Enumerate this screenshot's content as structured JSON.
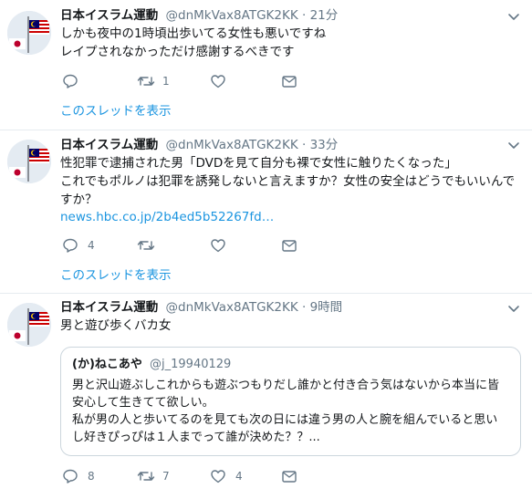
{
  "colors": {
    "link": "#1b95e0",
    "muted": "#657786",
    "divider": "#e6ecf0"
  },
  "tweets": [
    {
      "name": "日本イスラム運動",
      "handle": "@dnMkVax8ATGK2KK",
      "separator": "·",
      "time": "21分",
      "text": "しかも夜中の1時頃出歩いてる女性も悪いですね\nレイプされなかっただけ感謝するべきです",
      "counts": {
        "reply": "",
        "retweet": "1",
        "like": "",
        "dm": ""
      },
      "thread_link": "このスレッドを表示"
    },
    {
      "name": "日本イスラム運動",
      "handle": "@dnMkVax8ATGK2KK",
      "separator": "·",
      "time": "33分",
      "text": "性犯罪で逮捕された男「DVDを見て自分も裸で女性に触りたくなった」\nこれでもポルノは犯罪を誘発しないと言えますか？女性の安全はどうでもいいんですか？",
      "link": "news.hbc.co.jp/2b4ed5b52267fd…",
      "counts": {
        "reply": "4",
        "retweet": "",
        "like": "",
        "dm": ""
      },
      "thread_link": "このスレッドを表示"
    },
    {
      "name": "日本イスラム運動",
      "handle": "@dnMkVax8ATGK2KK",
      "separator": "·",
      "time": "9時間",
      "text": "男と遊び歩くバカ女",
      "quote": {
        "name": "(か)ねこあや",
        "handle": "@j_19940129",
        "text": "男と沢山遊ぶしこれからも遊ぶつもりだし誰かと付き合う気はないから本当に皆安心して生きてて欲しい。\n私が男の人と歩いてるのを見ても次の日には違う男の人と腕を組んでいると思いし好きぴっぴは１人までって誰が決めた？？..."
      },
      "counts": {
        "reply": "8",
        "retweet": "7",
        "like": "4",
        "dm": ""
      }
    }
  ]
}
